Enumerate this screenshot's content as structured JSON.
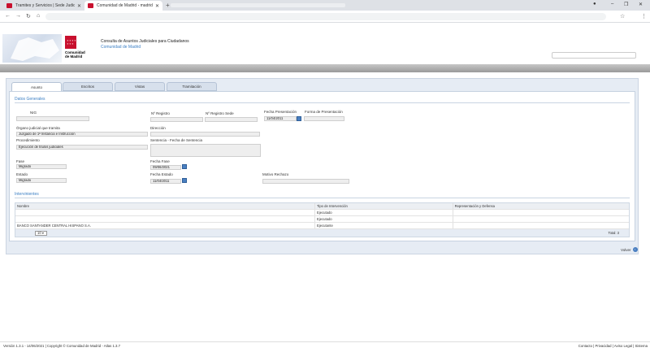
{
  "browser": {
    "tabs": [
      {
        "title": "Tramites y Servicios | Sede Judicia",
        "active": false
      },
      {
        "title": "Comunidad de Madrid - madrid",
        "active": true
      }
    ]
  },
  "header": {
    "logo_text_1": "Comunidad",
    "logo_text_2": "de Madrid",
    "title": "Consulta de Asuntos Judiciales para Ciudadanos",
    "subtitle": "Comunidad de Madrid"
  },
  "tabs": [
    {
      "label": "Asunto",
      "active": true
    },
    {
      "label": "Escritos",
      "active": false
    },
    {
      "label": "Vistas",
      "active": false
    },
    {
      "label": "Tramitación",
      "active": false
    }
  ],
  "datos": {
    "section_title": "Datos Generales",
    "nig_label": "NIG",
    "nig_value": "",
    "nregistro_label": "Nº Registro",
    "nregistro_sede_label": "Nº Registro Sede",
    "fecha_presentacion_label": "Fecha Presentación",
    "fecha_presentacion_value": "11/04/2011",
    "forma_presentacion_label": "Forma de Presentación",
    "organo_label": "Órgano judicial que tramita",
    "organo_value": "Juzgado de 1ª Instancia e Instrucción",
    "direccion_label": "Dirección",
    "procedimiento_label": "Procedimiento",
    "procedimiento_value": "Ejecución de títulos judiciales",
    "sentencia_label": "Sentencia - Fecha de Sentencia",
    "fase_label": "Fase",
    "fase_value": "Migrado",
    "fecha_fase_label": "Fecha Fase",
    "fecha_fase_value": "09/06/2021",
    "estado_label": "Estado",
    "estado_value": "Migrado",
    "fecha_estado_label": "Fecha Estado",
    "fecha_estado_value": "11/04/2011",
    "motivo_rechazo_label": "Motivo Rechazo"
  },
  "intervinientes": {
    "section_title": "Intervinientes",
    "columns": [
      "Nombre",
      "Tipo de Intervención",
      "Representación y Defensa"
    ],
    "rows": [
      [
        "",
        "Ejecutado",
        ""
      ],
      [
        "",
        "Ejecutado",
        ""
      ],
      [
        "BANCO SANTANDER CENTRAL HISPANO S.A.",
        "Ejecutante",
        ""
      ]
    ],
    "page_size": "10",
    "total": "Total: 3"
  },
  "volver_label": "Volver",
  "footer": {
    "version": "Versión 1.3.1 - 14/06/2021  |  Copyright © Comunidad de Madrid - Atlas 1.3.7",
    "links": "Contacto  |  Privacidad  |  Aviso Legal  |  Sistema"
  },
  "colors": {
    "brand_red": "#c8102e",
    "accent_blue": "#3b7fc4"
  }
}
